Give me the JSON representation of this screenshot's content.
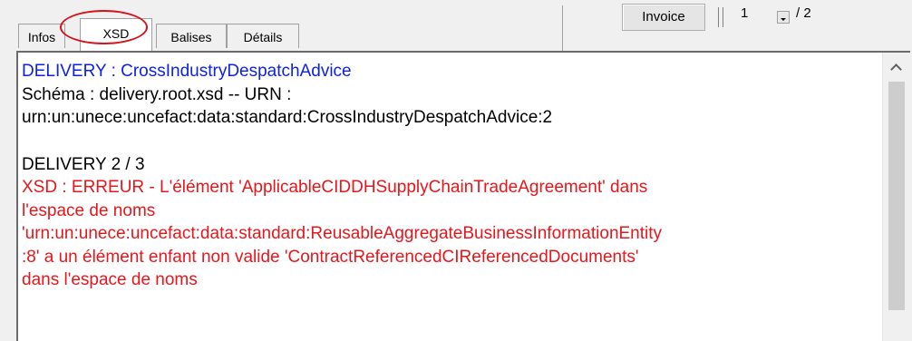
{
  "tabs": [
    {
      "label": "Infos",
      "active": false
    },
    {
      "label": "XSD",
      "active": true
    },
    {
      "label": "Balises",
      "active": false
    },
    {
      "label": "Détails",
      "active": false
    }
  ],
  "toolbar": {
    "invoice_label": "Invoice",
    "page_value": "1",
    "page_total": "/ 2"
  },
  "content": {
    "line1": "DELIVERY : CrossIndustryDespatchAdvice",
    "line2": "Schéma : delivery.root.xsd -- URN :",
    "line3": "urn:un:unece:uncefact:data:standard:CrossIndustryDespatchAdvice:2",
    "line4": "DELIVERY  2 /  3",
    "line5": "XSD : ERREUR - L'élément 'ApplicableCIDDHSupplyChainTradeAgreement' dans",
    "line6": "l'espace de noms",
    "line7": "'urn:un:unece:uncefact:data:standard:ReusableAggregateBusinessInformationEntity",
    "line8": ":8' a un élément enfant non valide 'ContractReferencedCIReferencedDocuments'",
    "line9": "dans l'espace de noms"
  },
  "colors": {
    "header_text": "#0d22e3",
    "error_text": "#e8161b",
    "highlight_ring": "#d3121b"
  }
}
